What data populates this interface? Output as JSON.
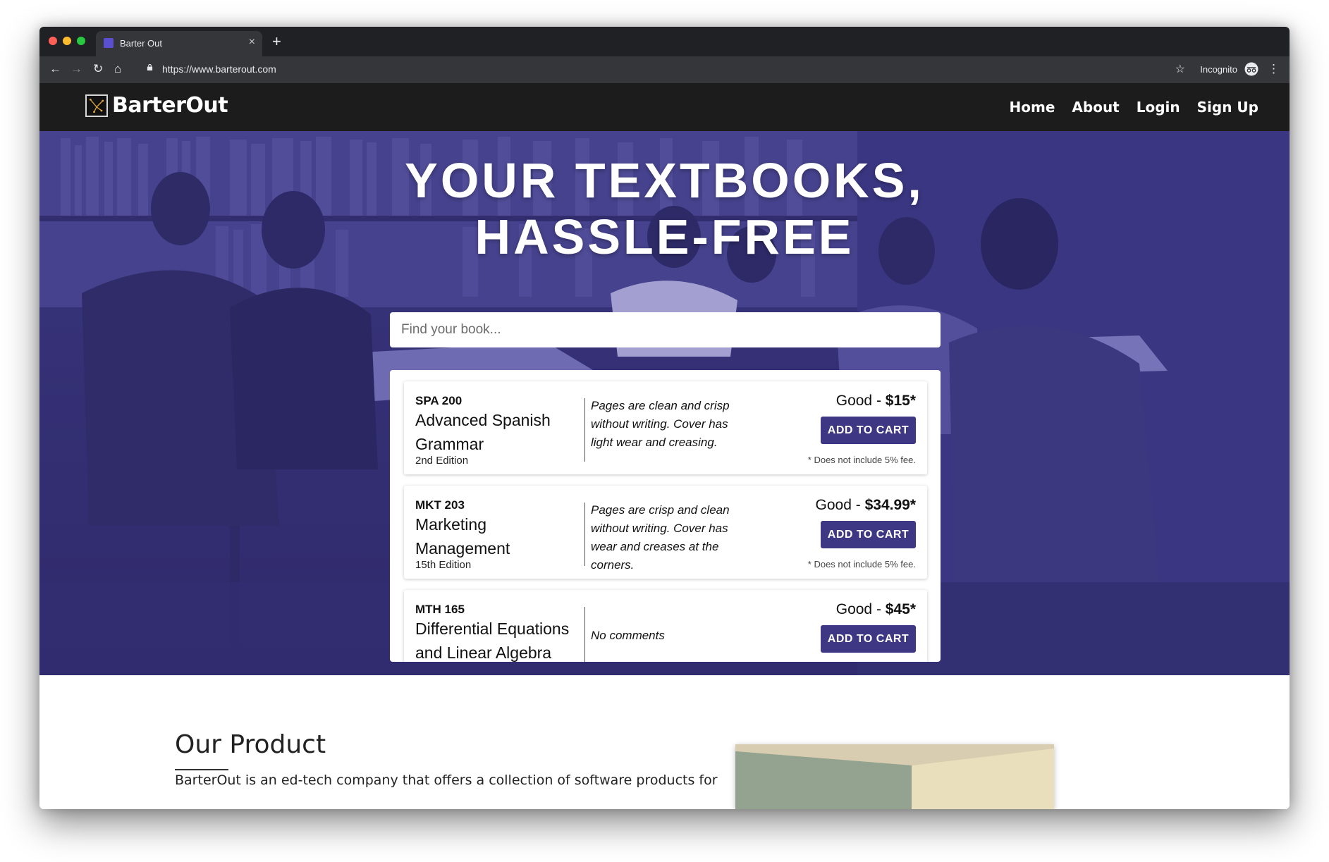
{
  "browser": {
    "tab_title": "Barter Out",
    "url": "https://www.barterout.com",
    "incognito_label": "Incognito",
    "new_tab_symbol": "+",
    "close_tab_symbol": "×"
  },
  "site": {
    "brand": "BarterOut",
    "nav": [
      "Home",
      "About",
      "Login",
      "Sign Up"
    ]
  },
  "hero": {
    "headline_line1": "YOUR TEXTBOOKS,",
    "headline_line2": "HASSLE-FREE",
    "search_placeholder": "Find your book..."
  },
  "results": [
    {
      "code": "SPA 200",
      "title": "Advanced Spanish Grammar",
      "edition": "2nd Edition",
      "comment": "Pages are clean and crisp without writing. Cover has light wear and creasing.",
      "condition": "Good - ",
      "price": "$15*",
      "button": "ADD TO CART",
      "fee_note": "* Does not include 5% fee."
    },
    {
      "code": "MKT 203",
      "title": "Marketing Management",
      "edition": "15th Edition",
      "comment": "Pages are crisp and clean without writing. Cover has wear and creases at the corners.",
      "condition": "Good - ",
      "price": "$34.99*",
      "button": "ADD TO CART",
      "fee_note": "* Does not include 5% fee."
    },
    {
      "code": "MTH 165",
      "title": "Differential Equations and Linear Algebra",
      "edition": "",
      "comment": "No comments",
      "condition": "Good - ",
      "price": "$45*",
      "button": "ADD TO CART",
      "fee_note": ""
    }
  ],
  "section": {
    "heading": "Our Product",
    "body": "BarterOut is an ed-tech company that offers a collection of software products for"
  },
  "colors": {
    "accent": "#3e3783",
    "nav_bg": "#1c1c1c",
    "hero_tint": "#3b3680"
  },
  "icons": [
    "back-icon",
    "forward-icon",
    "reload-icon",
    "home-icon",
    "lock-icon",
    "star-icon",
    "incognito-icon",
    "menu-dots-icon"
  ]
}
